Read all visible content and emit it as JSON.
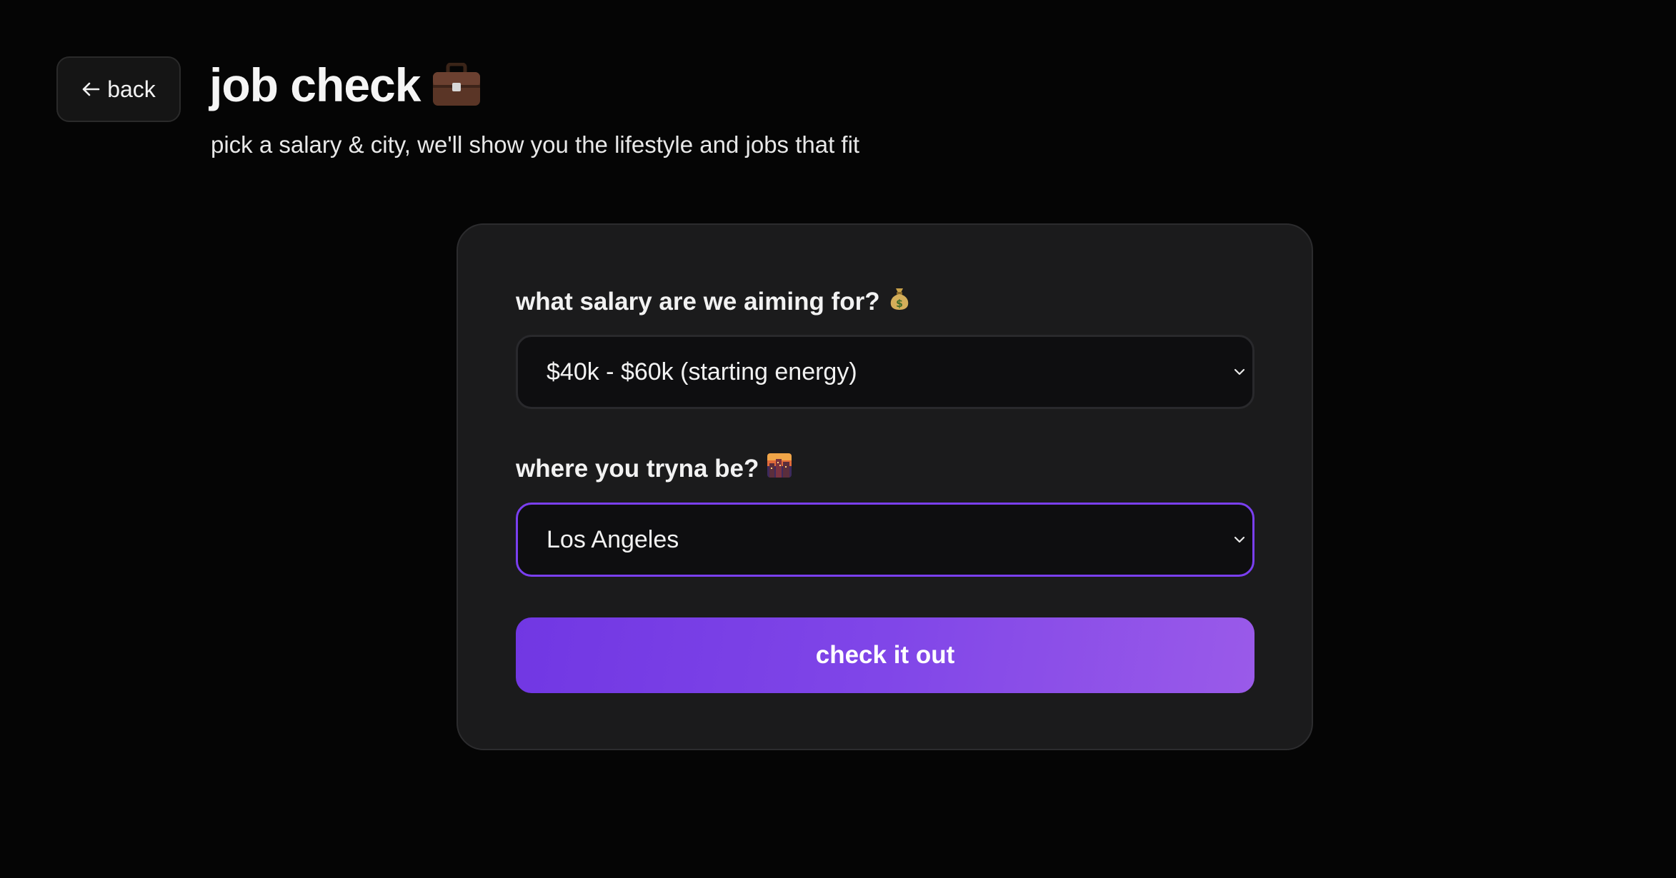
{
  "header": {
    "back_label": "back",
    "title": "job check",
    "title_icon": "briefcase-icon",
    "subtitle": "pick a salary & city, we'll show you the lifestyle and jobs that fit"
  },
  "form": {
    "salary": {
      "label": "what salary are we aiming for?",
      "label_icon": "money-bag-icon",
      "selected": "$40k - $60k (starting energy)"
    },
    "city": {
      "label": "where you tryna be?",
      "label_icon": "cityscape-icon",
      "selected": "Los Angeles",
      "focused": true
    },
    "submit_label": "check it out"
  },
  "colors": {
    "background": "#050505",
    "card": "#1b1b1c",
    "accent": "#7a3ff0",
    "button_gradient_start": "#7137e3",
    "button_gradient_end": "#9a5ae9"
  }
}
